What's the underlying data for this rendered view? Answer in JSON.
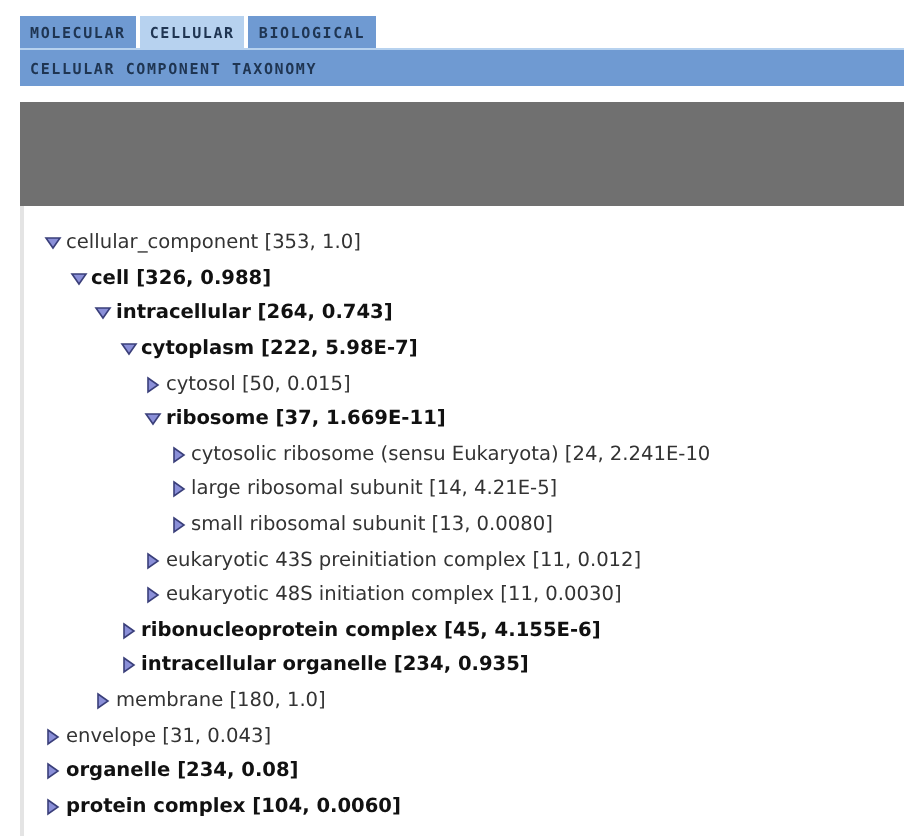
{
  "tabs": [
    {
      "label": "MOLECULAR",
      "selected": false
    },
    {
      "label": "CELLULAR",
      "selected": true
    },
    {
      "label": "BIOLOGICAL",
      "selected": false
    }
  ],
  "header": "CELLULAR COMPONENT TAXONOMY",
  "tree": [
    {
      "label": "cellular_component [353, 1.0]",
      "bold": false,
      "expanded": true,
      "children": [
        {
          "label": "cell [326, 0.988]",
          "bold": true,
          "expanded": true,
          "children": [
            {
              "label": "intracellular [264, 0.743]",
              "bold": true,
              "expanded": true,
              "children": [
                {
                  "label": "cytoplasm [222, 5.98E-7]",
                  "bold": true,
                  "expanded": true,
                  "children": [
                    {
                      "label": "cytosol [50, 0.015]",
                      "bold": false,
                      "expanded": false
                    },
                    {
                      "label": "ribosome [37, 1.669E-11]",
                      "bold": true,
                      "expanded": true,
                      "children": [
                        {
                          "label": "cytosolic ribosome (sensu Eukaryota) [24, 2.241E-10",
                          "bold": false,
                          "expanded": false
                        },
                        {
                          "label": "large ribosomal subunit [14, 4.21E-5]",
                          "bold": false,
                          "expanded": false
                        },
                        {
                          "label": "small ribosomal subunit [13, 0.0080]",
                          "bold": false,
                          "expanded": false
                        }
                      ]
                    },
                    {
                      "label": "eukaryotic 43S preinitiation complex [11, 0.012]",
                      "bold": false,
                      "expanded": false
                    },
                    {
                      "label": "eukaryotic 48S initiation complex [11, 0.0030]",
                      "bold": false,
                      "expanded": false
                    }
                  ]
                },
                {
                  "label": "ribonucleoprotein complex [45, 4.155E-6]",
                  "bold": true,
                  "expanded": false
                },
                {
                  "label": "intracellular organelle [234, 0.935]",
                  "bold": true,
                  "expanded": false
                }
              ]
            },
            {
              "label": "membrane [180, 1.0]",
              "bold": false,
              "expanded": false
            }
          ]
        }
      ]
    },
    {
      "label": "envelope [31, 0.043]",
      "bold": false,
      "expanded": false
    },
    {
      "label": "organelle [234, 0.08]",
      "bold": true,
      "expanded": false
    },
    {
      "label": "protein complex [104, 0.0060]",
      "bold": true,
      "expanded": false
    }
  ]
}
